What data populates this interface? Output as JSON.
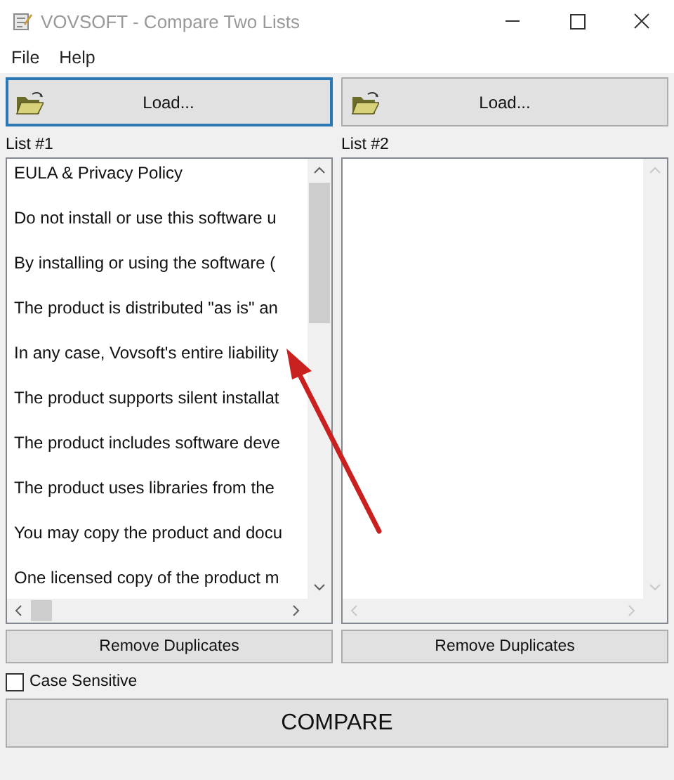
{
  "window": {
    "title": "VOVSOFT - Compare Two Lists"
  },
  "menu": [
    "File",
    "Help"
  ],
  "lists": [
    {
      "load_button": {
        "label": "Load...",
        "focused": true
      },
      "label": "List #1",
      "items": [
        "EULA & Privacy Policy",
        "Do not install or use this software u",
        "By installing or using the software (",
        "The product is distributed \"as is\" an",
        "In any case, Vovsoft's entire liability",
        "The product supports silent installat",
        "The product includes software deve",
        "The product uses libraries from the",
        "You may copy the product and docu",
        "One licensed copy of the product m"
      ],
      "remove_button": "Remove Duplicates"
    },
    {
      "load_button": {
        "label": "Load...",
        "focused": false
      },
      "label": "List #2",
      "remove_button": "Remove Duplicates"
    }
  ],
  "case_sensitive": {
    "label": "Case Sensitive",
    "checked": false
  },
  "compare_button": "COMPARE"
}
